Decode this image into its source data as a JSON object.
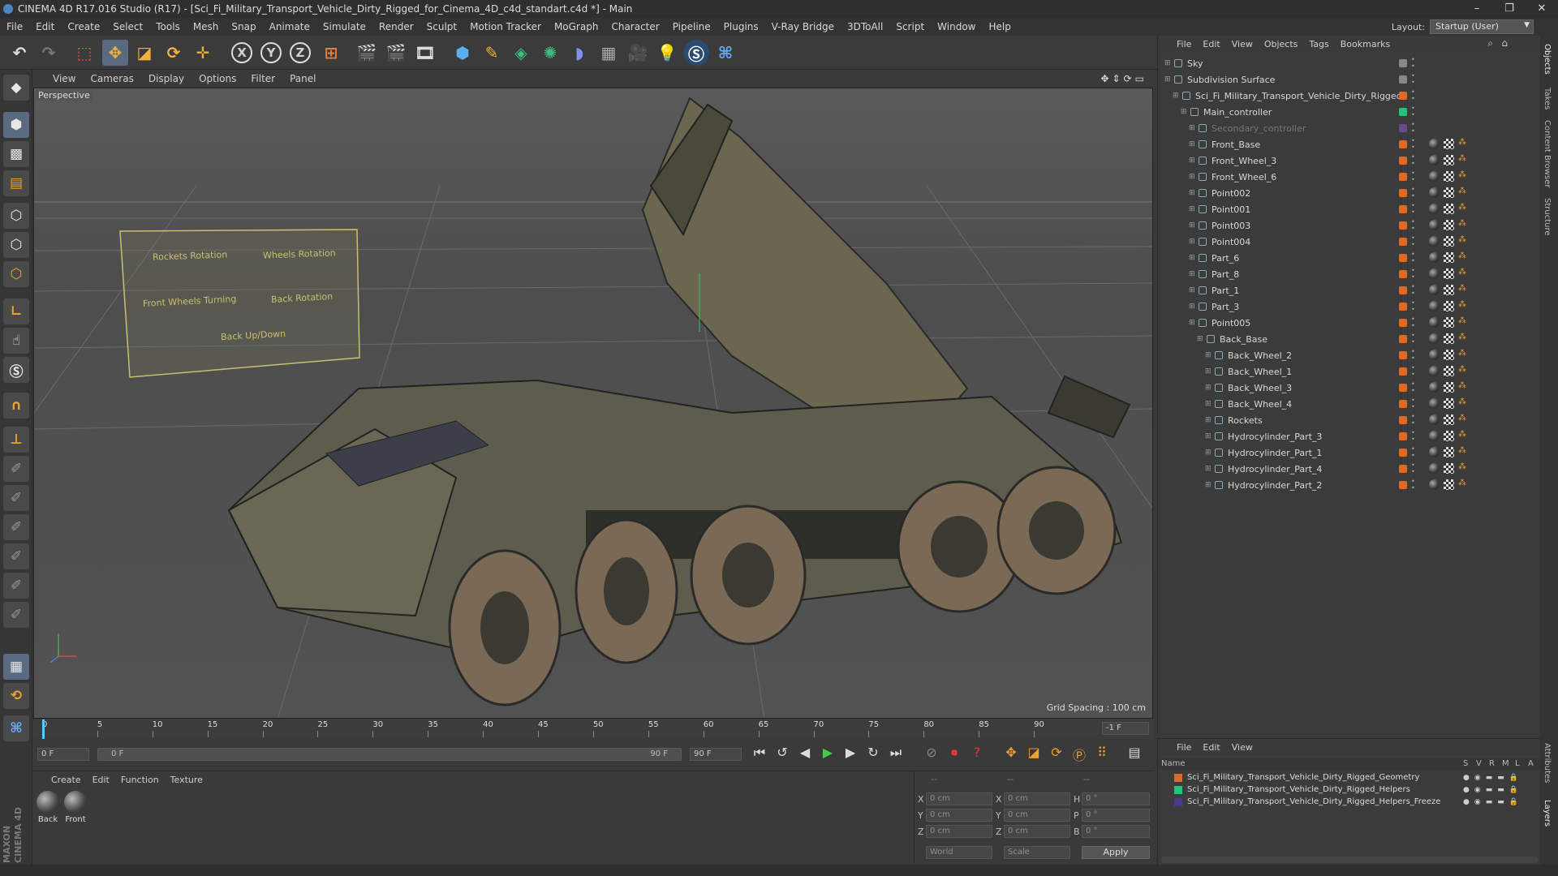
{
  "window": {
    "title": "CINEMA 4D R17.016 Studio (R17) - [Sci_Fi_Military_Transport_Vehicle_Dirty_Rigged_for_Cinema_4D_c4d_standart.c4d *] - Main",
    "controls": [
      "–",
      "❐",
      "✕"
    ]
  },
  "menubar": {
    "items": [
      "File",
      "Edit",
      "Create",
      "Select",
      "Tools",
      "Mesh",
      "Snap",
      "Animate",
      "Simulate",
      "Render",
      "Sculpt",
      "Motion Tracker",
      "MoGraph",
      "Character",
      "Pipeline",
      "Plugins",
      "V-Ray Bridge",
      "3DToAll",
      "Script",
      "Window",
      "Help"
    ],
    "layout_label": "Layout:",
    "layout_value": "Startup (User)"
  },
  "toolbar": {
    "axis_x": "X",
    "axis_y": "Y",
    "axis_z": "Z"
  },
  "viewport": {
    "menu": [
      "View",
      "Cameras",
      "Display",
      "Options",
      "Filter",
      "Panel"
    ],
    "label": "Perspective",
    "grid_spacing": "Grid Spacing : 100 cm",
    "hud_labels": [
      "Rockets Rotation",
      "Wheels Rotation",
      "Front Wheels Turning",
      "Back Rotation",
      "Back Up/Down"
    ]
  },
  "timeline": {
    "ticks": [
      "0",
      "5",
      "10",
      "15",
      "20",
      "25",
      "30",
      "35",
      "40",
      "45",
      "50",
      "55",
      "60",
      "65",
      "70",
      "75",
      "80",
      "85",
      "90"
    ],
    "end_frame_display": "-1 F",
    "current_frame": "0 F",
    "range_start": "0 F",
    "range_end": "90 F",
    "max_frame": "90 F"
  },
  "material_panel": {
    "menu": [
      "Create",
      "Edit",
      "Function",
      "Texture"
    ],
    "materials": [
      {
        "name": "Back"
      },
      {
        "name": "Front"
      }
    ]
  },
  "coord_panel": {
    "header": [
      "--",
      "--",
      "--"
    ],
    "rows": [
      {
        "axis": "X",
        "pos": "0 cm",
        "size_axis": "X",
        "size": "0 cm",
        "rot_axis": "H",
        "rot": "0 °"
      },
      {
        "axis": "Y",
        "pos": "0 cm",
        "size_axis": "Y",
        "size": "0 cm",
        "rot_axis": "P",
        "rot": "0 °"
      },
      {
        "axis": "Z",
        "pos": "0 cm",
        "size_axis": "Z",
        "size": "0 cm",
        "rot_axis": "B",
        "rot": "0 °"
      }
    ],
    "mode_world": "World",
    "mode_scale": "Scale",
    "apply": "Apply"
  },
  "object_manager": {
    "menu": [
      "File",
      "Edit",
      "View",
      "Objects",
      "Tags",
      "Bookmarks"
    ],
    "rows": [
      {
        "name": "Sky",
        "indent": 0,
        "color": "#888888"
      },
      {
        "name": "Subdivision Surface",
        "indent": 0,
        "color": "#888888"
      },
      {
        "name": "Sci_Fi_Military_Transport_Vehicle_Dirty_Rigged",
        "indent": 1,
        "color": "#e06a20"
      },
      {
        "name": "Main_controller",
        "indent": 2,
        "color": "#25c27a"
      },
      {
        "name": "Secondary_controller",
        "indent": 3,
        "color": "#6a4a8a"
      },
      {
        "name": "Front_Base",
        "indent": 3,
        "color": "#e06a20"
      },
      {
        "name": "Front_Wheel_3",
        "indent": 3,
        "color": "#e06a20"
      },
      {
        "name": "Front_Wheel_6",
        "indent": 3,
        "color": "#e06a20"
      },
      {
        "name": "Point002",
        "indent": 3,
        "color": "#e06a20"
      },
      {
        "name": "Point001",
        "indent": 3,
        "color": "#e06a20"
      },
      {
        "name": "Point003",
        "indent": 3,
        "color": "#e06a20"
      },
      {
        "name": "Point004",
        "indent": 3,
        "color": "#e06a20"
      },
      {
        "name": "Part_6",
        "indent": 3,
        "color": "#e06a20"
      },
      {
        "name": "Part_8",
        "indent": 3,
        "color": "#e06a20"
      },
      {
        "name": "Part_1",
        "indent": 3,
        "color": "#e06a20"
      },
      {
        "name": "Part_3",
        "indent": 3,
        "color": "#e06a20"
      },
      {
        "name": "Point005",
        "indent": 3,
        "color": "#e06a20"
      },
      {
        "name": "Back_Base",
        "indent": 4,
        "color": "#e06a20"
      },
      {
        "name": "Back_Wheel_2",
        "indent": 5,
        "color": "#e06a20"
      },
      {
        "name": "Back_Wheel_1",
        "indent": 5,
        "color": "#e06a20"
      },
      {
        "name": "Back_Wheel_3",
        "indent": 5,
        "color": "#e06a20"
      },
      {
        "name": "Back_Wheel_4",
        "indent": 5,
        "color": "#e06a20"
      },
      {
        "name": "Rockets",
        "indent": 5,
        "color": "#e06a20"
      },
      {
        "name": "Hydrocylinder_Part_3",
        "indent": 5,
        "color": "#e06a20"
      },
      {
        "name": "Hydrocylinder_Part_1",
        "indent": 5,
        "color": "#e06a20"
      },
      {
        "name": "Hydrocylinder_Part_4",
        "indent": 5,
        "color": "#e06a20"
      },
      {
        "name": "Hydrocylinder_Part_2",
        "indent": 5,
        "color": "#e06a20"
      }
    ]
  },
  "layer_manager": {
    "menu": [
      "File",
      "Edit",
      "View"
    ],
    "header_name": "Name",
    "header_cols": [
      "S",
      "V",
      "R",
      "M",
      "L",
      "A"
    ],
    "layers": [
      {
        "name": "Sci_Fi_Military_Transport_Vehicle_Dirty_Rigged_Geometry",
        "color": "#e06a20"
      },
      {
        "name": "Sci_Fi_Military_Transport_Vehicle_Dirty_Rigged_Helpers",
        "color": "#25c27a"
      },
      {
        "name": "Sci_Fi_Military_Transport_Vehicle_Dirty_Rigged_Helpers_Freeze",
        "color": "#4a3a8a"
      }
    ]
  },
  "right_tabs": [
    "Objects",
    "Takes",
    "Content Browser",
    "Structure",
    "Attributes",
    "Layers"
  ],
  "branding": {
    "logo_text": "MAXON CINEMA 4D"
  }
}
